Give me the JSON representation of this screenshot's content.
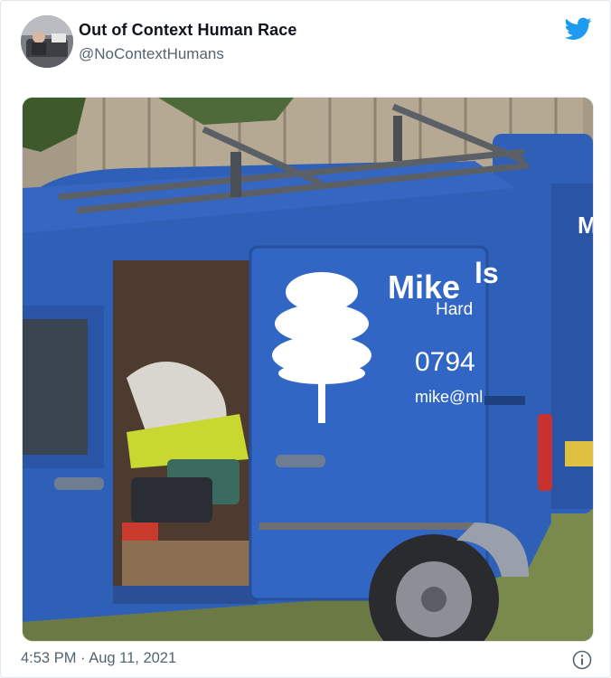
{
  "tweet": {
    "display_name": "Out of Context Human Race",
    "handle": "@NoContextHumans",
    "timestamp": "4:53 PM · Aug 11, 2021"
  },
  "media": {
    "van_brand": "Mike",
    "van_brand_suffix": "ls",
    "van_subtitle": "Hard",
    "van_phone": "0794",
    "van_email": "mike@ml",
    "next_van_letter": "M"
  },
  "icons": {
    "logo": "twitter-bird-icon",
    "info": "info-icon"
  },
  "colors": {
    "twitter_blue": "#1d9bf0",
    "van_blue": "#2f60b8",
    "text_primary": "#0f1419",
    "text_secondary": "#536471"
  }
}
